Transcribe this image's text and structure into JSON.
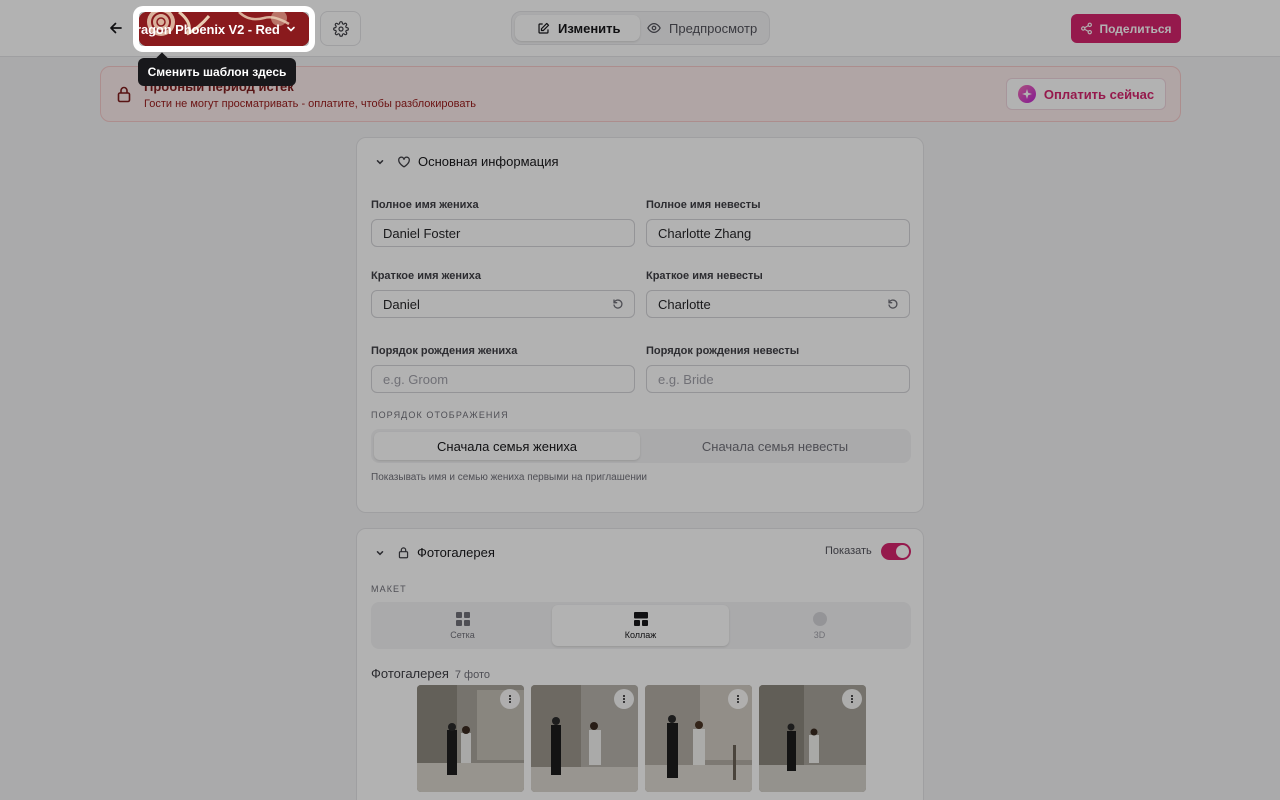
{
  "header": {
    "template_name": "ragon Phoenix V2 - Red",
    "mode_edit": "Изменить",
    "mode_preview": "Предпросмотр",
    "share_label": "Поделиться"
  },
  "tooltip": {
    "text": "Сменить шаблон здесь"
  },
  "trial": {
    "title": "Пробный период истёк",
    "subtitle": "Гости не могут просматривать - оплатите, чтобы разблокировать",
    "pay_label": "Оплатить сейчас"
  },
  "basic_info": {
    "title": "Основная информация",
    "groom_full_label": "Полное имя жениха",
    "groom_full_value": "Daniel Foster",
    "bride_full_label": "Полное имя невесты",
    "bride_full_value": "Charlotte Zhang",
    "groom_short_label": "Краткое имя жениха",
    "groom_short_value": "Daniel",
    "bride_short_label": "Краткое имя невесты",
    "bride_short_value": "Charlotte",
    "groom_order_label": "Порядок рождения жениха",
    "groom_order_placeholder": "e.g. Groom",
    "bride_order_label": "Порядок рождения невесты",
    "bride_order_placeholder": "e.g. Bride",
    "display_order_caption": "ПОРЯДОК ОТОБРАЖЕНИЯ",
    "order_groom_first": "Сначала семья жениха",
    "order_bride_first": "Сначала семья невесты",
    "order_hint": "Показывать имя и семью жениха первыми на приглашении"
  },
  "gallery": {
    "title": "Фотогалерея",
    "show_label": "Показать",
    "show_enabled": true,
    "layout_caption": "МАКЕТ",
    "layout_grid": "Сетка",
    "layout_collage": "Коллаж",
    "layout_3d": "3D",
    "gallery_label": "Фотогалерея",
    "photo_count": "7 фото"
  },
  "colors": {
    "accent": "#d6246e",
    "template_bg": "#8a1a1d",
    "banner_bg": "#fdecec"
  }
}
